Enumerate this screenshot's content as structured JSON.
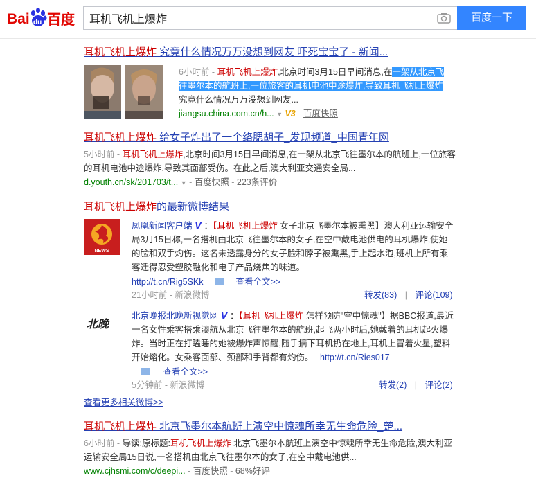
{
  "header": {
    "logo_text_left": "Bai",
    "logo_text_du": "du",
    "logo_text_right": "百度",
    "query": "耳机飞机上爆炸",
    "search_button": "百度一下",
    "brand_red": "#e10602",
    "brand_blue": "#2932e1"
  },
  "results": [
    {
      "title_em": "耳机飞机上爆炸",
      "title_rest": " 究竟什么情况万万没想到网友 吓死宝宝了 - 新闻...",
      "time": "6小时前",
      "dash": " - ",
      "snippet_em": "耳机飞机上爆炸",
      "snippet_a": ",北京时间3月15日早间消息,在",
      "snippet_sel1": "一架从北京",
      "snippet_sel2": "飞往墨尔本的航班上,一位旅客的耳机电池中途爆炸,导致耳机飞机上",
      "snippet_sel3": "爆炸",
      "snippet_b": " 究竟什么情况万万没想到网友...",
      "url": "jiangsu.china.com.cn/h...",
      "v3": "V3",
      "cache": "百度快照"
    },
    {
      "title_em": "耳机飞机上爆炸",
      "title_rest": " 给女子炸出了一个络腮胡子_发现频道_中国青年网",
      "time": "5小时前",
      "dash": " - ",
      "snippet_em": "耳机飞机上爆炸",
      "snippet_a": ",北京时间3月15日早间消息,在一架从北京飞往墨尔本的航班上,一位旅客的耳机电池中途爆炸,导致其面部受伤。在此之后,澳大利亚交通安全局...",
      "url": "d.youth.cn/sk/201703/t...",
      "cache": "百度快照",
      "reviews": "223条评价"
    }
  ],
  "weibo": {
    "title_em": "耳机飞机上爆炸",
    "title_rest": "的最新微博结果",
    "posts": [
      {
        "author": "凤凰新闻客户端",
        "colon": "：",
        "em": "【耳机飞机上爆炸",
        "text": " 女子北京飞墨尔本被熏黑】澳大利亚运输安全局3月15日称,一名搭机由北京飞往墨尔本的女子,在空中戴电池供电的耳机爆炸,使她的脸和双手灼伤。这名未透露身分的女子脸和脖子被熏黑,手上起水泡,班机上所有乘客迁得忍受塑胶融化和电子产品烧焦的味道。",
        "link": "http://t.cn/Rig5SKk",
        "fulltext": "查看全文>>",
        "time": "21小时前 - 新浪微博",
        "repost": "转发(83)",
        "comment": "评论(109)",
        "logo_label": "NEWS"
      },
      {
        "author": "北京晚报北晚新视觉网",
        "colon": "：",
        "em": "【耳机飞机上爆炸",
        "text": " 怎样预防\"空中惊魂\"】据BBC报道,最近一名女性乘客搭乘澳航从北京飞往墨尔本的航班,起飞两小时后,她戴着的耳机起火爆炸。当时正在打瞌睡的她被爆炸声惊醒,随手摘下耳机扔在地上,耳机上冒着火星,塑料开始熔化。女乘客面部、颈部和手背都有灼伤。",
        "link": "http://t.cn/Ries017",
        "fulltext": "查看全文>>",
        "time": "5分钟前 - 新浪微博",
        "repost": "转发(2)",
        "comment": "评论(2)",
        "logo_label": "北晚"
      }
    ],
    "more": "查看更多相关微博>>"
  },
  "result3": {
    "title_em": "耳机飞机上爆炸",
    "title_rest": " 北京飞墨尔本航班上演空中惊魂所幸无生命危险_楚...",
    "time": "6小时前",
    "dash": " - ",
    "snippet_a": "导读:原标题:",
    "snippet_em": "耳机飞机上爆炸",
    "snippet_b": " 北京飞墨尔本航班上演空中惊魂所幸无生命危险,澳大利亚运输安全局15日说,一名搭机由北京飞往墨尔本的女子,在空中戴电池供...",
    "url": "www.cjhsmi.com/c/deepi...",
    "cache": "百度快照",
    "reviews": "68%好评"
  }
}
